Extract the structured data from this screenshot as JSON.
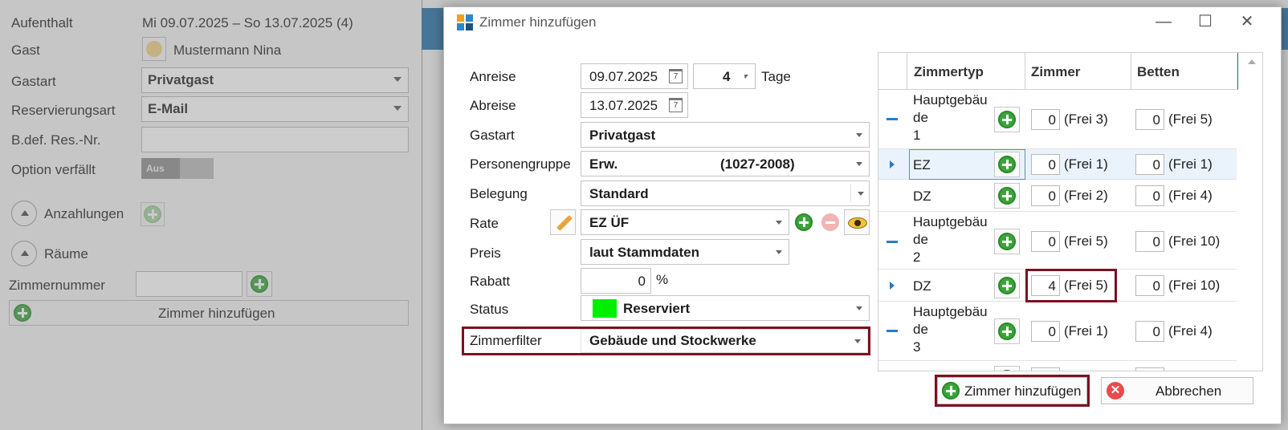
{
  "background": {
    "fields": {
      "aufenthalt_label": "Aufenthalt",
      "aufenthalt_value": "Mi 09.07.2025 – So 13.07.2025 (4)",
      "gast_label": "Gast",
      "gast_value": "Mustermann Nina",
      "gastart_label": "Gastart",
      "gastart_value": "Privatgast",
      "reservierungsart_label": "Reservierungsart",
      "reservierungsart_value": "E-Mail",
      "bdef_label": "B.def. Res.-Nr.",
      "bdef_value": "",
      "option_label": "Option verfällt",
      "option_toggle": "Aus"
    },
    "sections": {
      "anzahlungen": "Anzahlungen",
      "raeume": "Räume"
    },
    "zimmernummer_label": "Zimmernummer",
    "zimmernummer_value": "",
    "add_room_row_label": "Zimmer hinzufügen"
  },
  "dialog": {
    "title": "Zimmer hinzufügen",
    "window_buttons": {
      "minimize": "—",
      "maximize": "☐",
      "close": "✕"
    },
    "form": {
      "anreise_label": "Anreise",
      "anreise_value": "09.07.2025",
      "tage_value": "4",
      "tage_label": "Tage",
      "abreise_label": "Abreise",
      "abreise_value": "13.07.2025",
      "calendar_glyph": "7",
      "gastart_label": "Gastart",
      "gastart_value": "Privatgast",
      "personengruppe_label": "Personengruppe",
      "personengruppe_value": "Erw.",
      "personengruppe_code": "(1027-2008)",
      "belegung_label": "Belegung",
      "belegung_value": "Standard",
      "rate_label": "Rate",
      "rate_value": "EZ ÜF",
      "preis_label": "Preis",
      "preis_value": "laut Stammdaten",
      "rabatt_label": "Rabatt",
      "rabatt_value": "0",
      "rabatt_unit": "%",
      "status_label": "Status",
      "status_value": "Reserviert",
      "status_color": "#00ee00",
      "zimmerfilter_label": "Zimmerfilter",
      "zimmerfilter_value": "Gebäude und Stockwerke"
    },
    "grid": {
      "headers": {
        "zimmertyp": "Zimmertyp",
        "zimmer": "Zimmer",
        "betten": "Betten"
      },
      "rows": [
        {
          "name_lines": [
            "Hauptgebäu",
            "de",
            "1"
          ],
          "zimmer": "0",
          "zimmer_frei": "(Frei 3)",
          "betten": "0",
          "betten_frei": "(Frei 5)"
        },
        {
          "name": "EZ",
          "zimmer": "0",
          "zimmer_frei": "(Frei 1)",
          "betten": "0",
          "betten_frei": "(Frei 1)"
        },
        {
          "name": "DZ",
          "zimmer": "0",
          "zimmer_frei": "(Frei 2)",
          "betten": "0",
          "betten_frei": "(Frei 4)"
        },
        {
          "name_lines": [
            "Hauptgebäu",
            "de",
            "2"
          ],
          "zimmer": "0",
          "zimmer_frei": "(Frei 5)",
          "betten": "0",
          "betten_frei": "(Frei 10)"
        },
        {
          "name": "DZ",
          "zimmer": "4",
          "zimmer_frei": "(Frei 5)",
          "betten": "0",
          "betten_frei": "(Frei 10)"
        },
        {
          "name_lines": [
            "Hauptgebäu",
            "de",
            "3"
          ],
          "zimmer": "0",
          "zimmer_frei": "(Frei 1)",
          "betten": "0",
          "betten_frei": "(Frei 4)"
        }
      ]
    },
    "buttons": {
      "add": "Zimmer hinzufügen",
      "cancel": "Abbrechen"
    }
  },
  "colors": {
    "highlight": "#7a1220",
    "plus_green": "#3aa53a",
    "accent_blue": "#2a7bc4"
  }
}
